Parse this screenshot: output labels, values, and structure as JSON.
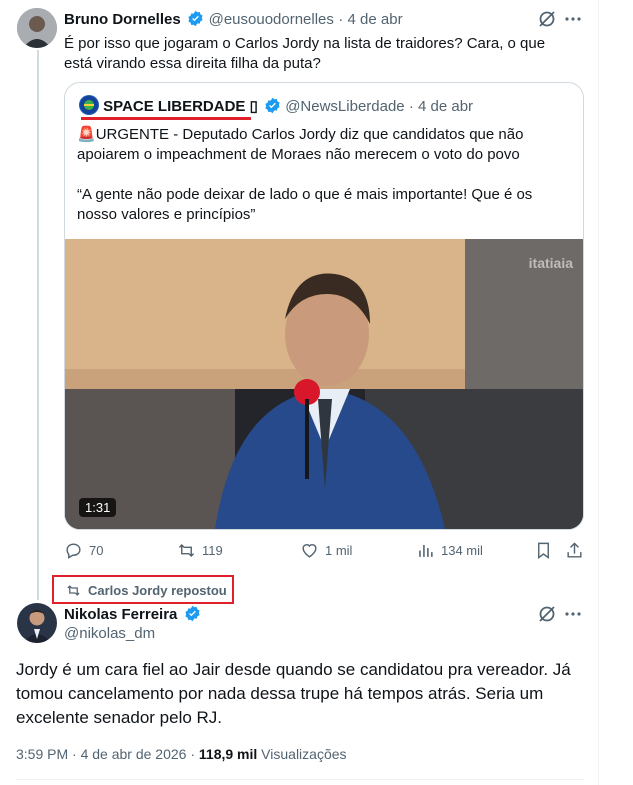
{
  "tweet1": {
    "name": "Bruno Dornelles",
    "handle": "@eusouodornelles",
    "time": "· 4 de abr",
    "text": "É por isso que jogaram o Carlos Jordy na lista de traidores? Cara, o que está virando essa direita filha da puta?"
  },
  "quote": {
    "name": "SPACE LIBERDADE ▯",
    "handle": "@NewsLiberdade",
    "time": "· 4 de abr",
    "siren": "🚨",
    "text1": "URGENTE - Deputado Carlos Jordy diz que candidatos que não apoiarem o impeachment de Moraes não merecem o voto do povo",
    "text2": "“A gente não pode deixar de lado o que é mais importante! Que é os nosso valores e princípios”",
    "video_duration": "1:31",
    "video_watermark": "itatiaia"
  },
  "actions": {
    "replies": "70",
    "reposts": "119",
    "likes": "1 mil",
    "views": "134 mil"
  },
  "repost_banner": "Carlos Jordy repostou",
  "tweet2": {
    "name": "Nikolas Ferreira",
    "handle": "@nikolas_dm",
    "text": "Jordy é um cara fiel ao Jair desde quando se candidatou pra vereador. Já tomou cancelamento por nada dessa trupe há tempos atrás. Seria um excelente senador pelo RJ.",
    "timestamp": "3:59 PM · 4 de abr de 2026 ·",
    "views_count": "118,9 mil",
    "views_label": "Visualizações"
  },
  "colors": {
    "verified": "#1d9bf0",
    "highlight": "#e0202a",
    "muted": "#536471"
  }
}
